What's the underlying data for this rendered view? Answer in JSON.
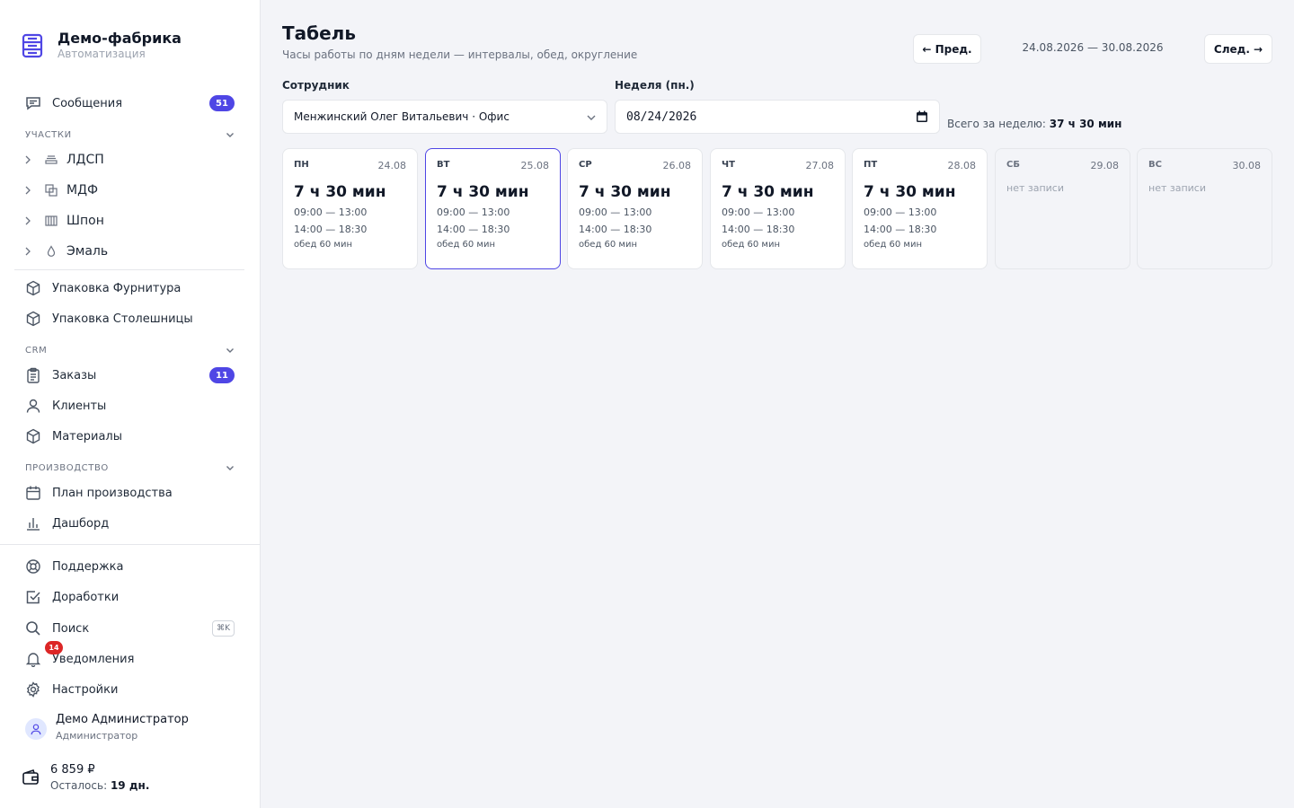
{
  "brand": {
    "name": "Демо-фабрика",
    "subtitle": "Автоматизация"
  },
  "sidebar": {
    "messages": {
      "label": "Сообщения",
      "badge": "51"
    },
    "sections": {
      "areas": "УЧАСТКИ",
      "crm": "CRM",
      "production": "ПРОИЗВОДСТВО"
    },
    "areas": [
      {
        "label": "ЛДСП"
      },
      {
        "label": "МДФ"
      },
      {
        "label": "Шпон"
      },
      {
        "label": "Эмаль"
      }
    ],
    "packaging": [
      {
        "label": "Упаковка Фурнитура"
      },
      {
        "label": "Упаковка Столешницы"
      }
    ],
    "crm": {
      "orders": {
        "label": "Заказы",
        "badge": "11"
      },
      "clients": {
        "label": "Клиенты"
      },
      "materials": {
        "label": "Материалы"
      }
    },
    "production": {
      "plan": {
        "label": "План производства"
      },
      "dashboard": {
        "label": "Дашборд"
      }
    },
    "bottom": {
      "support": {
        "label": "Поддержка"
      },
      "improvements": {
        "label": "Доработки"
      },
      "search": {
        "label": "Поиск",
        "shortcut": "⌘K"
      },
      "notifications": {
        "label": "Уведомления",
        "badge": "14"
      },
      "settings": {
        "label": "Настройки"
      }
    },
    "user": {
      "name": "Демо Администратор",
      "role": "Администратор"
    },
    "wallet": {
      "amount": "6 859 ₽",
      "left_label": "Осталось:",
      "left_value": "19 дн."
    }
  },
  "page": {
    "title": "Табель",
    "subtitle": "Часы работы по дням недели — интервалы, обед, округление",
    "prev_label": "← Пред.",
    "next_label": "След. →",
    "range": "24.08.2026 — 30.08.2026",
    "employee_label": "Сотрудник",
    "employee_value": "Менжинский Олег Витальевич · Офис",
    "week_label": "Неделя (пн.)",
    "week_value": "08/24/2026",
    "total_label": "Всего за неделю:",
    "total_value": "37 ч 30 мин"
  },
  "days": [
    {
      "name": "ПН",
      "date": "24.08",
      "hours": "7 ч 30 мин",
      "int1": "09:00 — 13:00",
      "int2": "14:00 — 18:30",
      "lunch": "обед 60 мин"
    },
    {
      "name": "ВТ",
      "date": "25.08",
      "hours": "7 ч 30 мин",
      "int1": "09:00 — 13:00",
      "int2": "14:00 — 18:30",
      "lunch": "обед 60 мин"
    },
    {
      "name": "СР",
      "date": "26.08",
      "hours": "7 ч 30 мин",
      "int1": "09:00 — 13:00",
      "int2": "14:00 — 18:30",
      "lunch": "обед 60 мин"
    },
    {
      "name": "ЧТ",
      "date": "27.08",
      "hours": "7 ч 30 мин",
      "int1": "09:00 — 13:00",
      "int2": "14:00 — 18:30",
      "lunch": "обед 60 мин"
    },
    {
      "name": "ПТ",
      "date": "28.08",
      "hours": "7 ч 30 мин",
      "int1": "09:00 — 13:00",
      "int2": "14:00 — 18:30",
      "lunch": "обед 60 мин"
    },
    {
      "name": "СБ",
      "date": "29.08",
      "empty": "нет записи"
    },
    {
      "name": "ВС",
      "date": "30.08",
      "empty": "нет записи"
    }
  ],
  "colors": {
    "accent": "#4f46e5",
    "badge_red": "#dc2626",
    "background": "#f3f4f8"
  }
}
